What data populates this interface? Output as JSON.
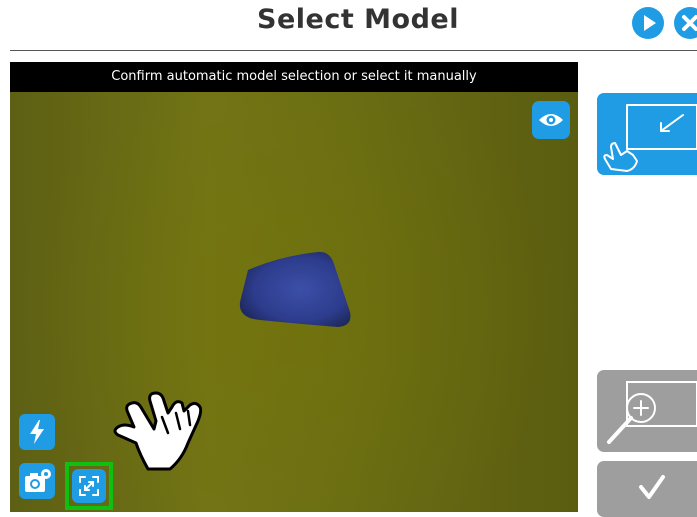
{
  "header": {
    "title": "Select Model"
  },
  "camera": {
    "instruction": "Confirm automatic model selection or select it manually"
  },
  "colors": {
    "accent": "#1f9ce4",
    "disabled": "#9e9e9e",
    "highlight": "#10c010",
    "camera_bar": "#000000"
  },
  "icons": {
    "play": "play-circle-icon",
    "close": "close-circle-icon",
    "eye": "eye-icon",
    "flash": "flash-icon",
    "snapshot": "camera-settings-icon",
    "fit": "fit-expand-icon",
    "select_area": "select-area-icon",
    "zoom": "zoom-area-icon",
    "confirm": "checkmark-icon",
    "tutorial_hand": "pointing-hand-icon"
  }
}
